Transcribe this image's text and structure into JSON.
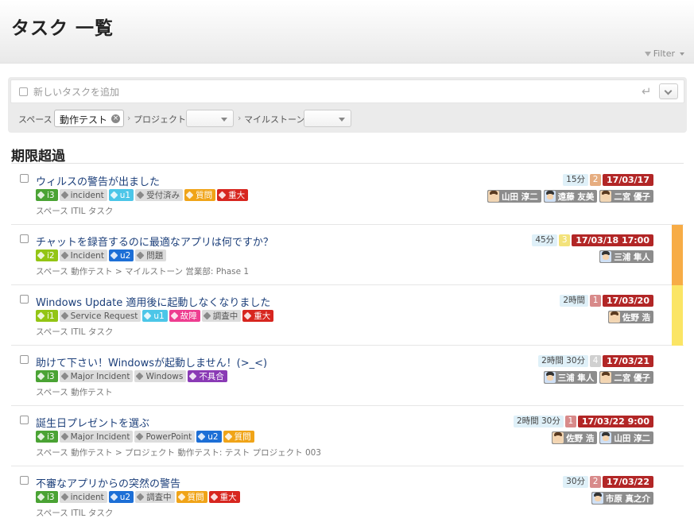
{
  "page": {
    "title": "タスク 一覧",
    "filter_label": "Filter"
  },
  "add": {
    "placeholder": "新しいタスクを追加",
    "space_label": "スペース",
    "space_value": "動作テスト",
    "project_label": "プロジェクト",
    "milestone_label": "マイルストーン"
  },
  "section": {
    "title": "期限超過"
  },
  "colors": {
    "overdue": "#b22626",
    "priority_high": "#f7ac46",
    "priority_mid": "#fbe565"
  },
  "tasks": [
    {
      "title": "ウィルスの警告が出ました",
      "tags": [
        {
          "label": "i3",
          "color": "green"
        },
        {
          "label": "incident",
          "color": "grey"
        },
        {
          "label": "u1",
          "color": "cyan"
        },
        {
          "label": "受付済み",
          "color": "grey"
        },
        {
          "label": "質問",
          "color": "orange"
        },
        {
          "label": "重大",
          "color": "red"
        }
      ],
      "path": "スペース ITIL タスク",
      "duration": "15分",
      "count": "2",
      "count_color": "#e6ad80",
      "due": "17/03/17",
      "users": [
        "山田 淳二",
        "遠藤 友美",
        "二宮 優子"
      ],
      "priority": null
    },
    {
      "title": "チャットを録音するのに最適なアプリは何ですか？",
      "tags": [
        {
          "label": "i2",
          "color": "lime"
        },
        {
          "label": "Incident",
          "color": "grey"
        },
        {
          "label": "u2",
          "color": "blue"
        },
        {
          "label": "問題",
          "color": "grey"
        }
      ],
      "path": "スペース 動作テスト > マイルストーン 営業部: Phase 1",
      "duration": "45分",
      "count": "3",
      "count_color": "#f3e27a",
      "due": "17/03/18 17:00",
      "users": [
        "三浦 隼人"
      ],
      "priority": "high"
    },
    {
      "title": "Windows Update 適用後に起動しなくなりました",
      "tags": [
        {
          "label": "i1",
          "color": "lime"
        },
        {
          "label": "Service Request",
          "color": "grey"
        },
        {
          "label": "u1",
          "color": "cyan"
        },
        {
          "label": "故障",
          "color": "pink"
        },
        {
          "label": "調査中",
          "color": "grey"
        },
        {
          "label": "重大",
          "color": "red"
        }
      ],
      "path": "スペース ITIL タスク",
      "duration": "2時間",
      "count": "1",
      "count_color": "#d88a8a",
      "due": "17/03/20",
      "users": [
        "佐野 浩"
      ],
      "priority": "mid"
    },
    {
      "title": "助けて下さい！Windowsが起動しません！(>_<)",
      "tags": [
        {
          "label": "i3",
          "color": "green"
        },
        {
          "label": "Major Incident",
          "color": "grey"
        },
        {
          "label": "Windows",
          "color": "grey"
        },
        {
          "label": "不具合",
          "color": "purple"
        }
      ],
      "path": "スペース 動作テスト",
      "duration": "2時間 30分",
      "count": "4",
      "count_color": "#d0d0d0",
      "due": "17/03/21",
      "users": [
        "三浦 隼人",
        "二宮 優子"
      ],
      "priority": null
    },
    {
      "title": "誕生日プレゼントを選ぶ",
      "tags": [
        {
          "label": "i3",
          "color": "green"
        },
        {
          "label": "Major Incident",
          "color": "grey"
        },
        {
          "label": "PowerPoint",
          "color": "grey"
        },
        {
          "label": "u2",
          "color": "blue"
        },
        {
          "label": "質問",
          "color": "orange"
        }
      ],
      "path": "スペース 動作テスト > プロジェクト 動作テスト: テスト プロジェクト 003",
      "duration": "2時間 30分",
      "count": "1",
      "count_color": "#d88a8a",
      "due": "17/03/22 9:00",
      "users": [
        "佐野 浩",
        "山田 淳二"
      ],
      "priority": null
    },
    {
      "title": "不審なアプリからの突然の警告",
      "tags": [
        {
          "label": "i3",
          "color": "green"
        },
        {
          "label": "incident",
          "color": "grey"
        },
        {
          "label": "u2",
          "color": "blue"
        },
        {
          "label": "調査中",
          "color": "grey"
        },
        {
          "label": "質問",
          "color": "orange"
        },
        {
          "label": "重大",
          "color": "red"
        }
      ],
      "path": "スペース ITIL タスク",
      "duration": "30分",
      "count": "2",
      "count_color": "#d88a8a",
      "due": "17/03/22",
      "users": [
        "市原 真之介"
      ],
      "priority": null
    }
  ]
}
